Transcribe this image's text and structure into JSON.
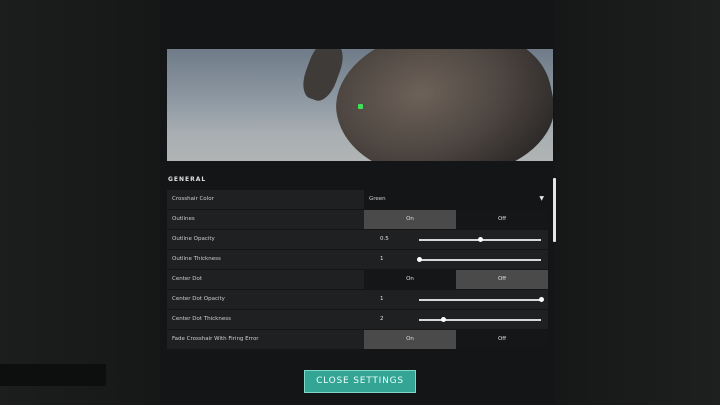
{
  "settings": {
    "section_title": "GENERAL",
    "crosshair_color": {
      "label": "Crosshair Color",
      "value": "Green"
    },
    "outlines": {
      "label": "Outlines",
      "on": "On",
      "off": "Off",
      "selected": "On"
    },
    "outline_opacity": {
      "label": "Outline Opacity",
      "value": "0.5",
      "fraction": 0.5
    },
    "outline_thickness": {
      "label": "Outline Thickness",
      "value": "1",
      "fraction": 0.0
    },
    "center_dot": {
      "label": "Center Dot",
      "on": "On",
      "off": "Off",
      "selected": "Off"
    },
    "center_dot_opacity": {
      "label": "Center Dot Opacity",
      "value": "1",
      "fraction": 1.0
    },
    "center_dot_thickness": {
      "label": "Center Dot Thickness",
      "value": "2",
      "fraction": 0.2
    },
    "fade_crosshair": {
      "label": "Fade Crosshair With Firing Error",
      "on": "On",
      "off": "Off",
      "selected": "On"
    }
  },
  "footer": {
    "close_label": "CLOSE SETTINGS"
  },
  "colors": {
    "accent": "#34a594",
    "crosshair": "#3ee05a"
  }
}
